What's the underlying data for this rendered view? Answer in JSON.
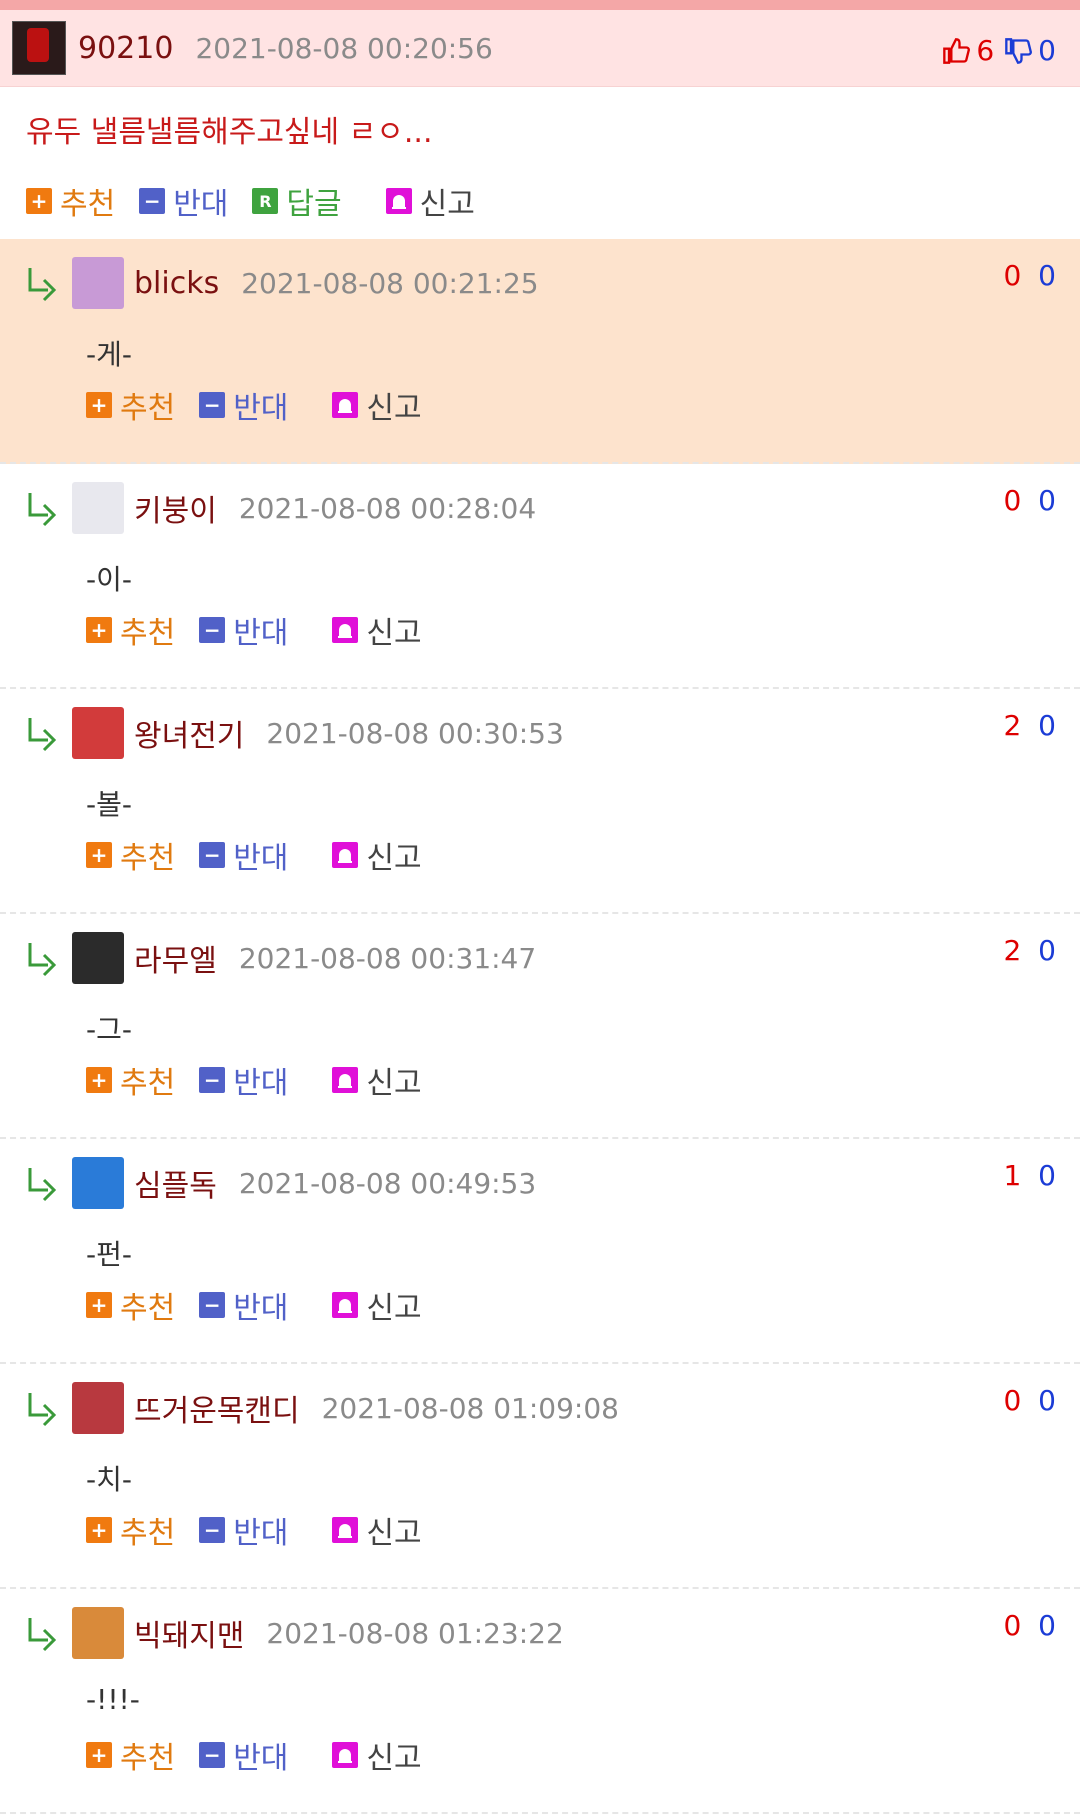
{
  "main_comment": {
    "author": "90210",
    "timestamp": "2021-08-08 00:20:56",
    "likes": "6",
    "dislikes": "0",
    "text": "유두 낼름낼름해주고싶네 ㄹㅇ...",
    "actions": {
      "recommend": "추천",
      "oppose": "반대",
      "reply": "답글",
      "report": "신고"
    },
    "icons": {
      "plus": "+",
      "minus": "−",
      "reply": "R"
    }
  },
  "replies": [
    {
      "author": "blicks",
      "timestamp": "2021-08-08 00:21:25",
      "up": "0",
      "down": "0",
      "text": "-게-",
      "avatar_color": "#c89ad6"
    },
    {
      "author": "키붕이",
      "timestamp": "2021-08-08 00:28:04",
      "up": "0",
      "down": "0",
      "text": "-이-",
      "avatar_color": "#e8e8ee"
    },
    {
      "author": "왕녀전기",
      "timestamp": "2021-08-08 00:30:53",
      "up": "2",
      "down": "0",
      "text": "-볼-",
      "avatar_color": "#d23b3b"
    },
    {
      "author": "라무엘",
      "timestamp": "2021-08-08 00:31:47",
      "up": "2",
      "down": "0",
      "text": "-그-",
      "avatar_color": "#2b2b2b"
    },
    {
      "author": "심플독",
      "timestamp": "2021-08-08 00:49:53",
      "up": "1",
      "down": "0",
      "text": "-펀-",
      "avatar_color": "#2a7bd8"
    },
    {
      "author": "뜨거운목캔디",
      "timestamp": "2021-08-08 01:09:08",
      "up": "0",
      "down": "0",
      "text": "-치-",
      "avatar_color": "#b8393f"
    },
    {
      "author": "빅돼지맨",
      "timestamp": "2021-08-08 01:23:22",
      "up": "0",
      "down": "0",
      "text": "-!!!-",
      "avatar_color": "#d98a3a"
    }
  ],
  "colors": {
    "header_bg": "#ffe3e3",
    "highlight_bg": "#fde3cd",
    "author": "#7a1010",
    "up_vote": "#dd0000",
    "down_vote": "#1b3cd6"
  }
}
